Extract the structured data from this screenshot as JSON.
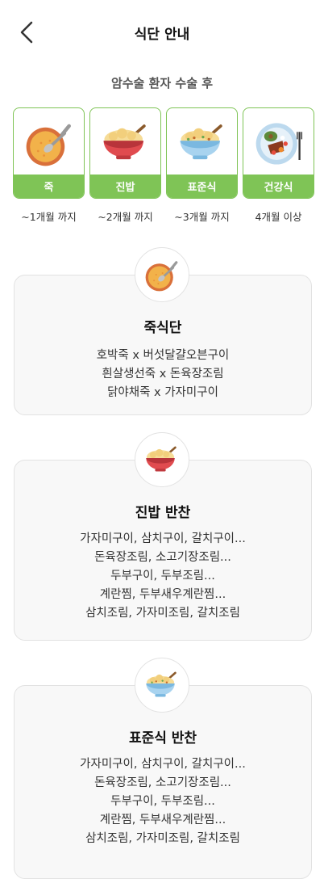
{
  "header": {
    "title": "식단 안내",
    "back_icon": "chevron-left-icon"
  },
  "subtitle": "암수술 환자 수술 후",
  "colors": {
    "accent_green": "#7fc456",
    "card_bg": "#f8f8f8",
    "border": "#e2e2e2"
  },
  "stages": [
    {
      "label": "죽",
      "period": "~1개월 까지",
      "icon": "porridge-bowl-icon"
    },
    {
      "label": "진밥",
      "period": "~2개월 까지",
      "icon": "rice-bowl-red-icon"
    },
    {
      "label": "표준식",
      "period": "~3개월 까지",
      "icon": "rice-bowl-blue-icon"
    },
    {
      "label": "건강식",
      "period": "4개월 이상",
      "icon": "healthy-plate-icon"
    }
  ],
  "menus": [
    {
      "title": "죽식단",
      "icon": "porridge-bowl-icon",
      "items": [
        "호박죽 x 버섯달걀오븐구이",
        "흰살생선죽 x 돈육장조림",
        "닭야채죽 x 가자미구이"
      ]
    },
    {
      "title": "진밥 반찬",
      "icon": "rice-bowl-red-icon",
      "items": [
        "가자미구이, 삼치구이, 갈치구이...",
        "돈육장조림, 소고기장조림...",
        "두부구이, 두부조림...",
        "계란찜, 두부새우계란찜...",
        "삼치조림, 가자미조림, 갈치조림"
      ]
    },
    {
      "title": "표준식 반찬",
      "icon": "rice-bowl-blue-icon",
      "items": [
        "가자미구이, 삼치구이, 갈치구이...",
        "돈육장조림, 소고기장조림...",
        "두부구이, 두부조림...",
        "계란찜, 두부새우계란찜...",
        "삼치조림, 가자미조림, 갈치조림"
      ]
    }
  ]
}
